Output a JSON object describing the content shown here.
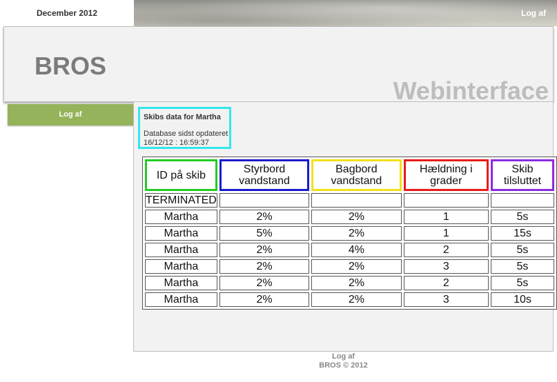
{
  "topbar": {
    "date": "December 2012",
    "logout": "Log af"
  },
  "header": {
    "brand": "BROS",
    "subtitle": "Webinterface"
  },
  "sidebar": {
    "items": [
      {
        "label": "Log af"
      }
    ]
  },
  "info": {
    "title": "Skibs data for Martha",
    "updated_label": "Database sidst opdateret",
    "updated_value": "16/12/12 : 16:59:37",
    "border_color": "#33e6ee"
  },
  "table": {
    "headers": [
      {
        "label": "ID på skib",
        "color": "#22cc22"
      },
      {
        "label": "Styrbord vandstand",
        "color": "#1a1acc"
      },
      {
        "label": "Bagbord vandstand",
        "color": "#f2e01a"
      },
      {
        "label": "Hældning i grader",
        "color": "#e81a1a"
      },
      {
        "label": "Skib tilsluttet",
        "color": "#8a2be2"
      }
    ],
    "rows": [
      [
        "TERMINATED",
        "",
        "",
        "",
        ""
      ],
      [
        "Martha",
        "2%",
        "2%",
        "1",
        "5s"
      ],
      [
        "Martha",
        "5%",
        "2%",
        "1",
        "15s"
      ],
      [
        "Martha",
        "2%",
        "4%",
        "2",
        "5s"
      ],
      [
        "Martha",
        "2%",
        "2%",
        "3",
        "5s"
      ],
      [
        "Martha",
        "2%",
        "2%",
        "2",
        "5s"
      ],
      [
        "Martha",
        "2%",
        "2%",
        "3",
        "10s"
      ]
    ]
  },
  "footer": {
    "link": "Log af",
    "copyright": "BROS © 2012"
  }
}
